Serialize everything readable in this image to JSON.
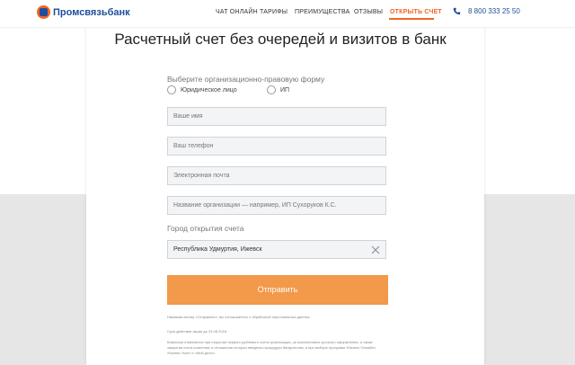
{
  "header": {
    "logo_text": "Промсвязьбанк",
    "nav": [
      "ЧАТ ОНЛАЙН",
      "ТАРИФЫ",
      "ПРЕИМУЩЕСТВА",
      "ОТЗЫВЫ",
      "ОТКРЫТЬ СЧЕТ"
    ],
    "active_nav": "ОТКРЫТЬ СЧЕТ",
    "phone": "8 800 333 25 50"
  },
  "main": {
    "title": "Расчетный счет без очередей и визитов в банк",
    "legal_form_label": "Выберите организационно-правовую форму",
    "legal_options": [
      "Юридическое лицо",
      "ИП"
    ],
    "fields": [
      {
        "placeholder": "Ваше имя"
      },
      {
        "placeholder": "Ваш телефон"
      },
      {
        "placeholder": "Электронная почта"
      },
      {
        "placeholder": "Название организации — например, ИП Сухоруков К.С."
      }
    ],
    "city_label": "Город открытия счета",
    "city_value": "Республика Удмуртия, Ижевск",
    "submit_label": "Отправить",
    "consent_text": "Нажимая кнопку «Отправить», вы соглашаетесь с обработкой персональных данных.",
    "promo_term": "Срок действия акции до 31.08.2018",
    "fine_print": "Комиссия отменяется при открытии первого рублевого счета организации, за исключением срочного оформления, а также закрытия счета клиентам, в отношении которых введены процедуры банкротства, и при выборе программ «Бизнес Онлайн», «Бизнес Нал» и «Мой делo»."
  },
  "colors": {
    "brand_blue": "#1f4e9a",
    "accent_orange": "#f26522",
    "button_orange": "#f2994a"
  }
}
